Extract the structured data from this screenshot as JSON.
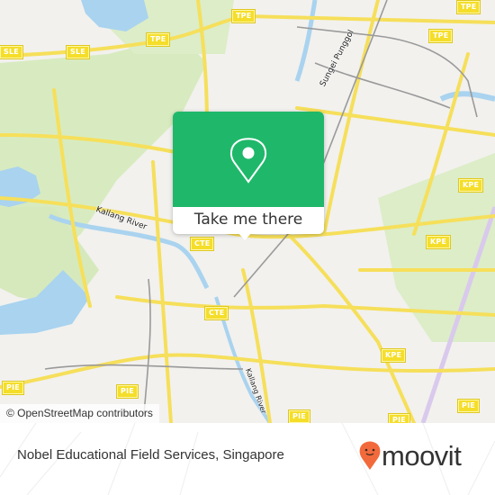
{
  "map": {
    "attribution": "© OpenStreetMap contributors",
    "shields": [
      {
        "label": "TPE"
      },
      {
        "label": "TPE"
      },
      {
        "label": "TPE"
      },
      {
        "label": "TPE"
      },
      {
        "label": "SLE"
      },
      {
        "label": "SLE"
      },
      {
        "label": "KPE"
      },
      {
        "label": "KPE"
      },
      {
        "label": "KPE"
      },
      {
        "label": "CTE"
      },
      {
        "label": "CTE"
      },
      {
        "label": "PIE"
      },
      {
        "label": "PIE"
      },
      {
        "label": "PIE"
      },
      {
        "label": "PIE"
      },
      {
        "label": "PIE"
      }
    ],
    "labels": {
      "kallang_river": "Kallang River",
      "sungei_punggol": "Sungei Punggol",
      "kallang_river_south": "Kallang River"
    },
    "colors": {
      "land": "#f2f1ee",
      "park": "#d8ebc0",
      "water": "#a9d3ef",
      "road": "#f6df5a",
      "rail": "#999999"
    }
  },
  "popup": {
    "icon": "map-pin-icon",
    "action_label": "Take me there",
    "color": "#1fb86a"
  },
  "footer": {
    "place_name": "Nobel Educational Field Services, Singapore",
    "brand": "moovit",
    "brand_color": "#f26a3b"
  }
}
